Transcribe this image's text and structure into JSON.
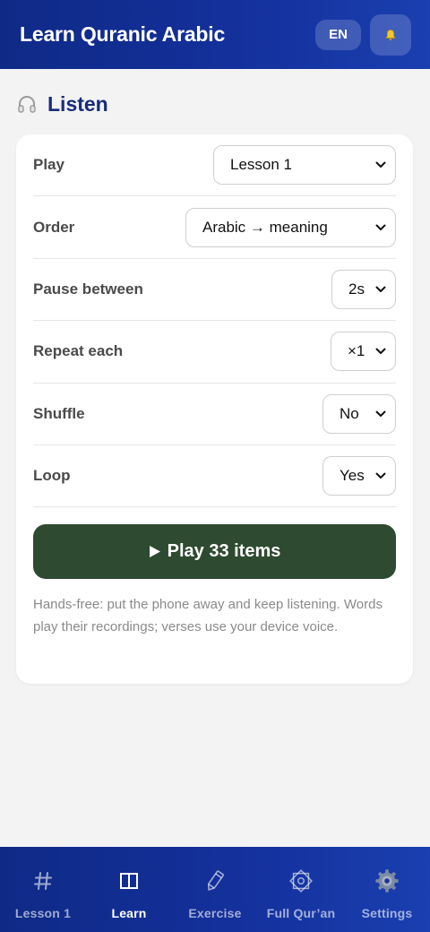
{
  "header": {
    "title": "Learn Quranic Arabic",
    "lang_label": "EN",
    "bell_icon": "bell-icon"
  },
  "section": {
    "title": "Listen",
    "icon": "headphones-icon"
  },
  "settings": [
    {
      "label": "Play",
      "value": "Lesson 1"
    },
    {
      "label": "Order",
      "value": "Arabic → meaning"
    },
    {
      "label": "Pause between",
      "value": "2s"
    },
    {
      "label": "Repeat each",
      "value": "×1"
    },
    {
      "label": "Shuffle",
      "value": "No"
    },
    {
      "label": "Loop",
      "value": "Yes"
    }
  ],
  "play_button": {
    "label": "Play 33 items"
  },
  "hint": "Hands-free: put the phone away and keep listening. Words play their recordings; verses use your device voice.",
  "nav": [
    {
      "label": "Lesson 1",
      "icon": "hash-icon",
      "active": false
    },
    {
      "label": "Learn",
      "icon": "book-icon",
      "active": true
    },
    {
      "label": "Exercise",
      "icon": "pencil-icon",
      "active": false
    },
    {
      "label": "Full Qur’an",
      "icon": "star-icon",
      "active": false
    },
    {
      "label": "Settings",
      "icon": "gear-icon",
      "active": false
    }
  ],
  "colors": {
    "header_bg": "#14309b",
    "accent_title": "#172d78",
    "play_button_bg": "#2e4a30"
  }
}
